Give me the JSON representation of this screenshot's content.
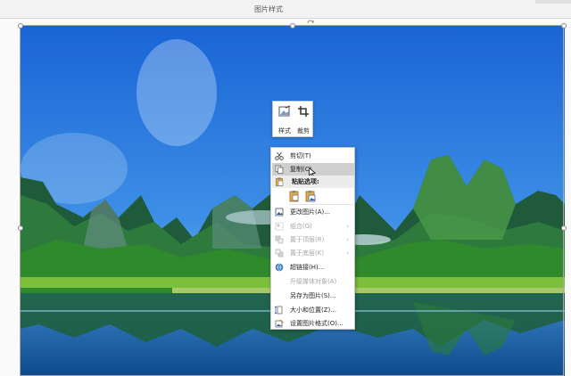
{
  "ribbon": {
    "group_label": "图片样式"
  },
  "mini_toolbar": {
    "style_label": "样式",
    "crop_label": "裁剪"
  },
  "context_menu": {
    "cut": "剪切(T)",
    "copy": "复制(C)",
    "paste_options": "粘贴选项:",
    "change_picture": "更改图片(A)...",
    "group": "组合(G)",
    "bring_to_front": "置于顶层(R)",
    "send_to_back": "置于底层(K)",
    "hyperlink": "超链接(H)...",
    "upgrade_media": "升级媒体对象(A)",
    "save_as_picture": "另存为图片(S)...",
    "size_position": "大小和位置(Z)...",
    "format_picture": "设置图片格式(O)..."
  },
  "colors": {
    "accent": "#2b579a",
    "menu_hover": "#cfcfcf"
  },
  "icons": [
    "scissors-icon",
    "copy-icon",
    "paste-icon",
    "change-picture-icon",
    "group-icon",
    "bring-front-icon",
    "send-back-icon",
    "hyperlink-icon",
    "size-position-icon",
    "format-picture-icon",
    "style-icon",
    "crop-icon"
  ]
}
